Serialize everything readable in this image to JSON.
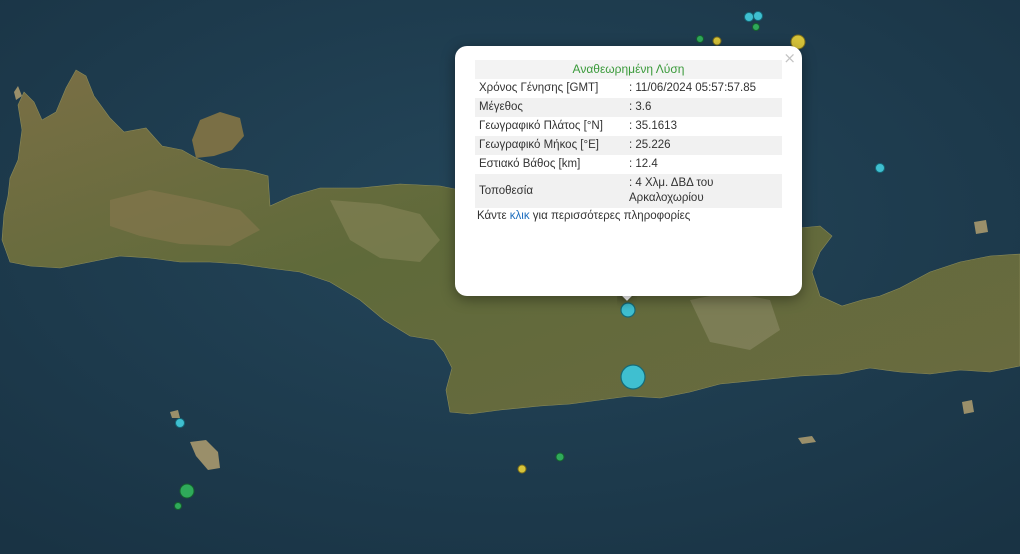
{
  "popup": {
    "title": "Αναθεωρημένη Λύση",
    "close_icon": "×",
    "rows": [
      {
        "label": "Χρόνος Γένησης [GMT]",
        "value": ": 11/06/2024 05:57:57.85"
      },
      {
        "label": "Μέγεθος",
        "value": ": 3.6"
      },
      {
        "label": "Γεωγραφικό Πλάτος [°N]",
        "value": ": 35.1613"
      },
      {
        "label": "Γεωγραφικό Μήκος [°E]",
        "value": ": 25.226"
      },
      {
        "label": "Εστιακό Βάθος [km]",
        "value": ": 12.4"
      },
      {
        "label": "Τοποθεσία",
        "value": ": 4 Χλμ. ΔΒΔ του Αρκαλοχωρίου"
      }
    ],
    "more_prefix": "Κάντε ",
    "more_link": "κλικ",
    "more_suffix": " για περισσότερες πληροφορίες"
  },
  "colors": {
    "sea": "#1f3e51",
    "land": "#6b6a3e",
    "marker_cyan": "#3fbfd0",
    "marker_green": "#2faa5a",
    "marker_yellow": "#d7c43a"
  }
}
